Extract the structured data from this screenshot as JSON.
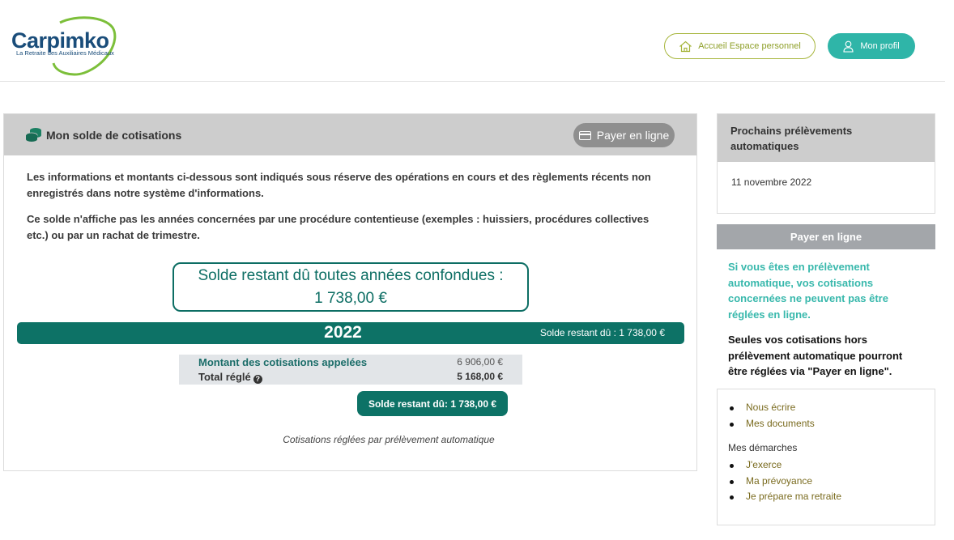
{
  "header": {
    "logo_name": "Carpimko",
    "logo_tagline": "La Retraite des Auxiliaires Médicaux",
    "home_button": "Accueil Espace personnel",
    "profile_button": "Mon profil"
  },
  "main": {
    "title": "Mon solde de cotisations",
    "pay_button": "Payer en ligne",
    "paragraph_1": "Les informations et montants ci-dessous sont indiqués sous réserve des opérations en cours et des règlements récents non enregistrés dans notre système d'informations.",
    "paragraph_2": "Ce solde n'affiche pas les années concernées par une procédure contentieuse (exemples : huissiers, procédures collectives etc.) ou par un rachat de trimestre.",
    "solde_total_label": "Solde restant dû toutes années confondues :",
    "solde_total_value": "1 738,00 €",
    "year": {
      "label": "2022",
      "solde": "Solde restant dû : 1 738,00 €",
      "rows": [
        {
          "label": "Montant des cotisations appelées",
          "value": "6 906,00 €"
        },
        {
          "label": "Total réglé",
          "value": "5 168,00 €"
        }
      ],
      "solde_button": "Solde restant dû: 1 738,00 €",
      "note": "Cotisations réglées par prélèvement automatique"
    }
  },
  "sidebar": {
    "prelevements_title": "Prochains prélèvements automatiques",
    "prelevements_date": "11 novembre 2022",
    "pay_title": "Payer en ligne",
    "pay_info_1": "Si vous êtes en prélèvement automatique, vos cotisations concernées ne peuvent pas être réglées en ligne.",
    "pay_info_2": "Seules vos cotisations hors prélèvement automatique pourront être réglées via \"Payer en ligne\".",
    "links": [
      "Nous écrire",
      "Mes documents"
    ],
    "demarches_label": "Mes démarches",
    "demarches": [
      "J'exerce",
      "Ma prévoyance",
      "Je prépare ma retraite"
    ]
  },
  "colors": {
    "brand_teal": "#0d7266",
    "accent_teal": "#2fb5a8",
    "accent_green": "#a6b53b",
    "logo_blue": "#1a4d7a"
  }
}
